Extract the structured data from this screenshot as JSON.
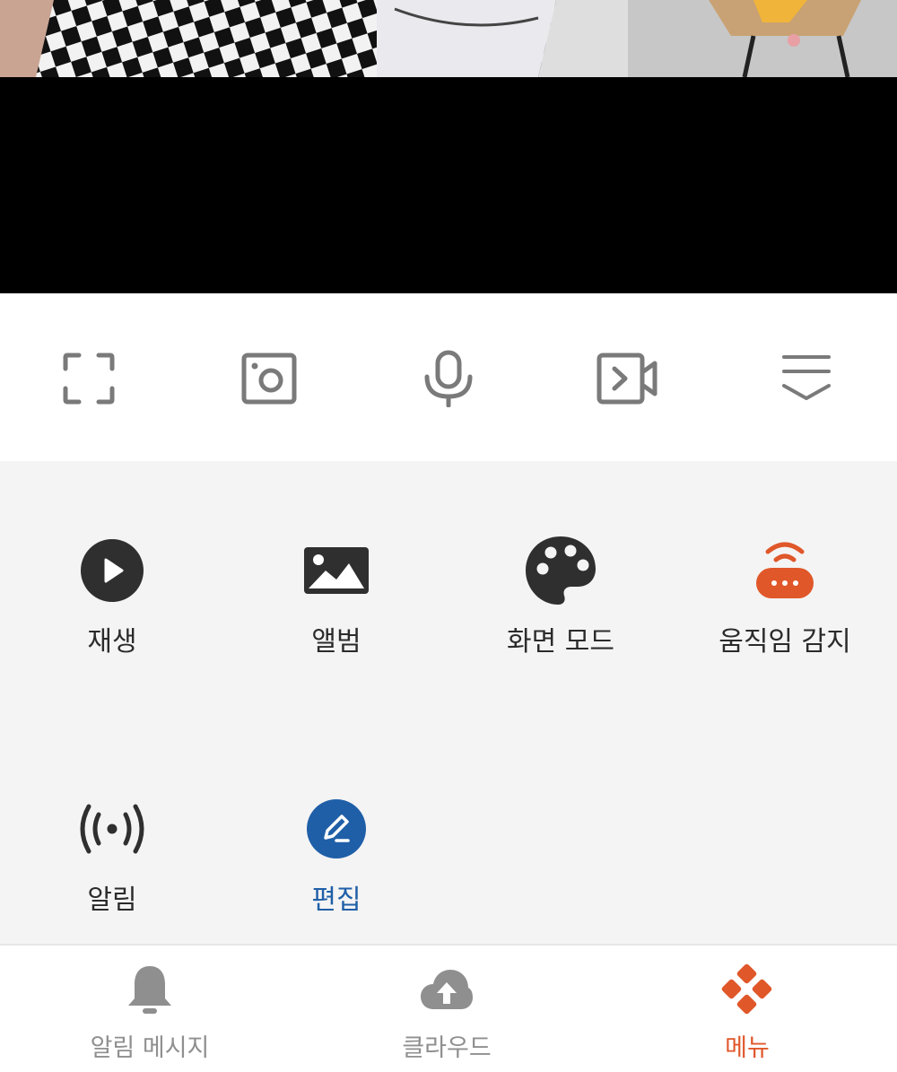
{
  "camera_feed": {
    "icon": "camera-live-feed"
  },
  "toolbar": {
    "buttons": [
      {
        "name": "fullscreen",
        "icon": "fullscreen-icon"
      },
      {
        "name": "snapshot",
        "icon": "snapshot-icon"
      },
      {
        "name": "microphone",
        "icon": "microphone-icon"
      },
      {
        "name": "record",
        "icon": "video-record-icon"
      },
      {
        "name": "collapse",
        "icon": "chevron-list-icon"
      }
    ]
  },
  "menu": {
    "items": [
      {
        "label": "재생",
        "icon": "play-circle-icon"
      },
      {
        "label": "앨범",
        "icon": "image-album-icon"
      },
      {
        "label": "화면 모드",
        "icon": "palette-icon"
      },
      {
        "label": "움직임 감지",
        "icon": "motion-sensor-icon"
      },
      {
        "label": "알림",
        "icon": "broadcast-signal-icon"
      },
      {
        "label": "편집",
        "icon": "pencil-edit-icon"
      }
    ]
  },
  "bottom_nav": {
    "items": [
      {
        "label": "알림 메시지",
        "icon": "bell-icon"
      },
      {
        "label": "클라우드",
        "icon": "cloud-upload-icon"
      },
      {
        "label": "메뉴",
        "icon": "menu-diamond-icon",
        "active": true
      }
    ]
  },
  "colors": {
    "accent_orange": "#e0572a",
    "edit_blue": "#1f5fa8",
    "icon_dark": "#2f2f2f",
    "icon_grey": "#7a7a7a",
    "menu_bg": "#f4f4f4"
  }
}
